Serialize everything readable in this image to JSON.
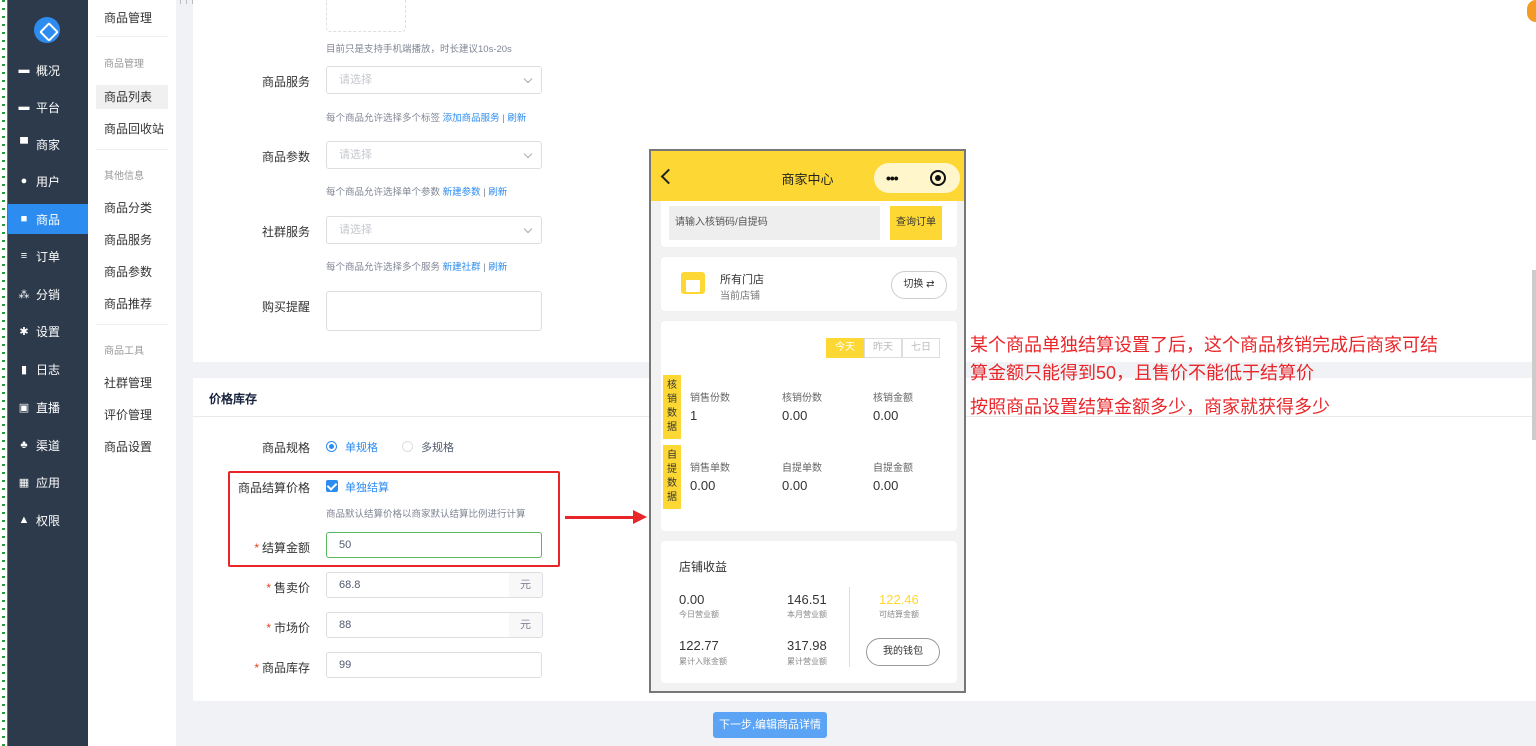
{
  "sidebar": {
    "items": [
      {
        "label": "概况",
        "icon": "monitor-icon"
      },
      {
        "label": "平台",
        "icon": "desktop-icon"
      },
      {
        "label": "商家",
        "icon": "store-icon"
      },
      {
        "label": "用户",
        "icon": "user-icon"
      },
      {
        "label": "商品",
        "icon": "product-icon"
      },
      {
        "label": "订单",
        "icon": "order-icon"
      },
      {
        "label": "分销",
        "icon": "distribution-icon"
      },
      {
        "label": "设置",
        "icon": "gear-icon"
      },
      {
        "label": "日志",
        "icon": "book-icon"
      },
      {
        "label": "直播",
        "icon": "live-icon"
      },
      {
        "label": "渠道",
        "icon": "channel-icon"
      },
      {
        "label": "应用",
        "icon": "grid-icon"
      },
      {
        "label": "权限",
        "icon": "lock-icon"
      }
    ],
    "active": "商品"
  },
  "submenu": {
    "header": "商品管理",
    "group1_title": "商品管理",
    "group1": [
      "商品列表",
      "商品回收站"
    ],
    "group2_title": "其他信息",
    "group2": [
      "商品分类",
      "商品服务",
      "商品参数",
      "商品推荐"
    ],
    "group3_title": "商品工具",
    "group3": [
      "社群管理",
      "评价管理",
      "商品设置"
    ]
  },
  "form": {
    "video_hint": "目前只是支持手机端播放，时长建议10s-20s",
    "service_label": "商品服务",
    "service_placeholder": "请选择",
    "service_hint": "每个商品允许选择多个标签",
    "service_link": "添加商品服务",
    "refresh": "刷新",
    "param_label": "商品参数",
    "param_placeholder": "请选择",
    "param_hint": "每个商品允许选择单个参数",
    "param_link": "新建参数",
    "community_label": "社群服务",
    "community_placeholder": "请选择",
    "community_hint": "每个商品允许选择多个服务",
    "community_link": "新建社群",
    "remind_label": "购买提醒",
    "separator": "|"
  },
  "price": {
    "section_title": "价格库存",
    "spec_label": "商品规格",
    "spec_single": "单规格",
    "spec_multi": "多规格",
    "settle_label": "商品结算价格",
    "settle_checkbox": "单独结算",
    "settle_hint": "商品默认结算价格以商家默认结算比例进行计算",
    "settle_amount_label": "结算金额",
    "settle_amount": "50",
    "sale_label": "售卖价",
    "sale_value": "68.8",
    "unit": "元",
    "market_label": "市场价",
    "market_value": "88",
    "stock_label": "商品库存",
    "stock_value": "99",
    "required_mark": "*"
  },
  "next_button": "下一步,编辑商品详情",
  "phone": {
    "title": "商家中心",
    "capsule_dots": "•••",
    "search_placeholder": "请输入核销码/自提码",
    "search_button": "查询订单",
    "store_name": "所有门店",
    "store_sub": "当前店铺",
    "switch_label": "切换 ⇄",
    "tabs": [
      "今天",
      "昨天",
      "七日"
    ],
    "tag_verify": "核销数据",
    "tag_pickup": "自提数据",
    "verify_stats": [
      {
        "label": "销售份数",
        "value": "1"
      },
      {
        "label": "核销份数",
        "value": "0.00"
      },
      {
        "label": "核销金额",
        "value": "0.00"
      }
    ],
    "pickup_stats": [
      {
        "label": "销售单数",
        "value": "0.00"
      },
      {
        "label": "自提单数",
        "value": "0.00"
      },
      {
        "label": "自提金额",
        "value": "0.00"
      }
    ],
    "income_title": "店铺收益",
    "income": [
      {
        "label": "今日营业额",
        "value": "0.00"
      },
      {
        "label": "本月营业额",
        "value": "146.51"
      },
      {
        "label": "可结算金额",
        "value": "122.46"
      },
      {
        "label": "累计入账金额",
        "value": "122.77"
      },
      {
        "label": "累计营业额",
        "value": "317.98"
      }
    ],
    "wallet_button": "我的钱包",
    "accent": "#fdd835"
  },
  "annotation": {
    "line1": "某个商品单独结算设置了后，这个商品核销完成后商家可结",
    "line2": "算金额只能得到50，且售价不能低于结算价",
    "line3": "按照商品设置结算金额多少，商家就获得多少"
  }
}
